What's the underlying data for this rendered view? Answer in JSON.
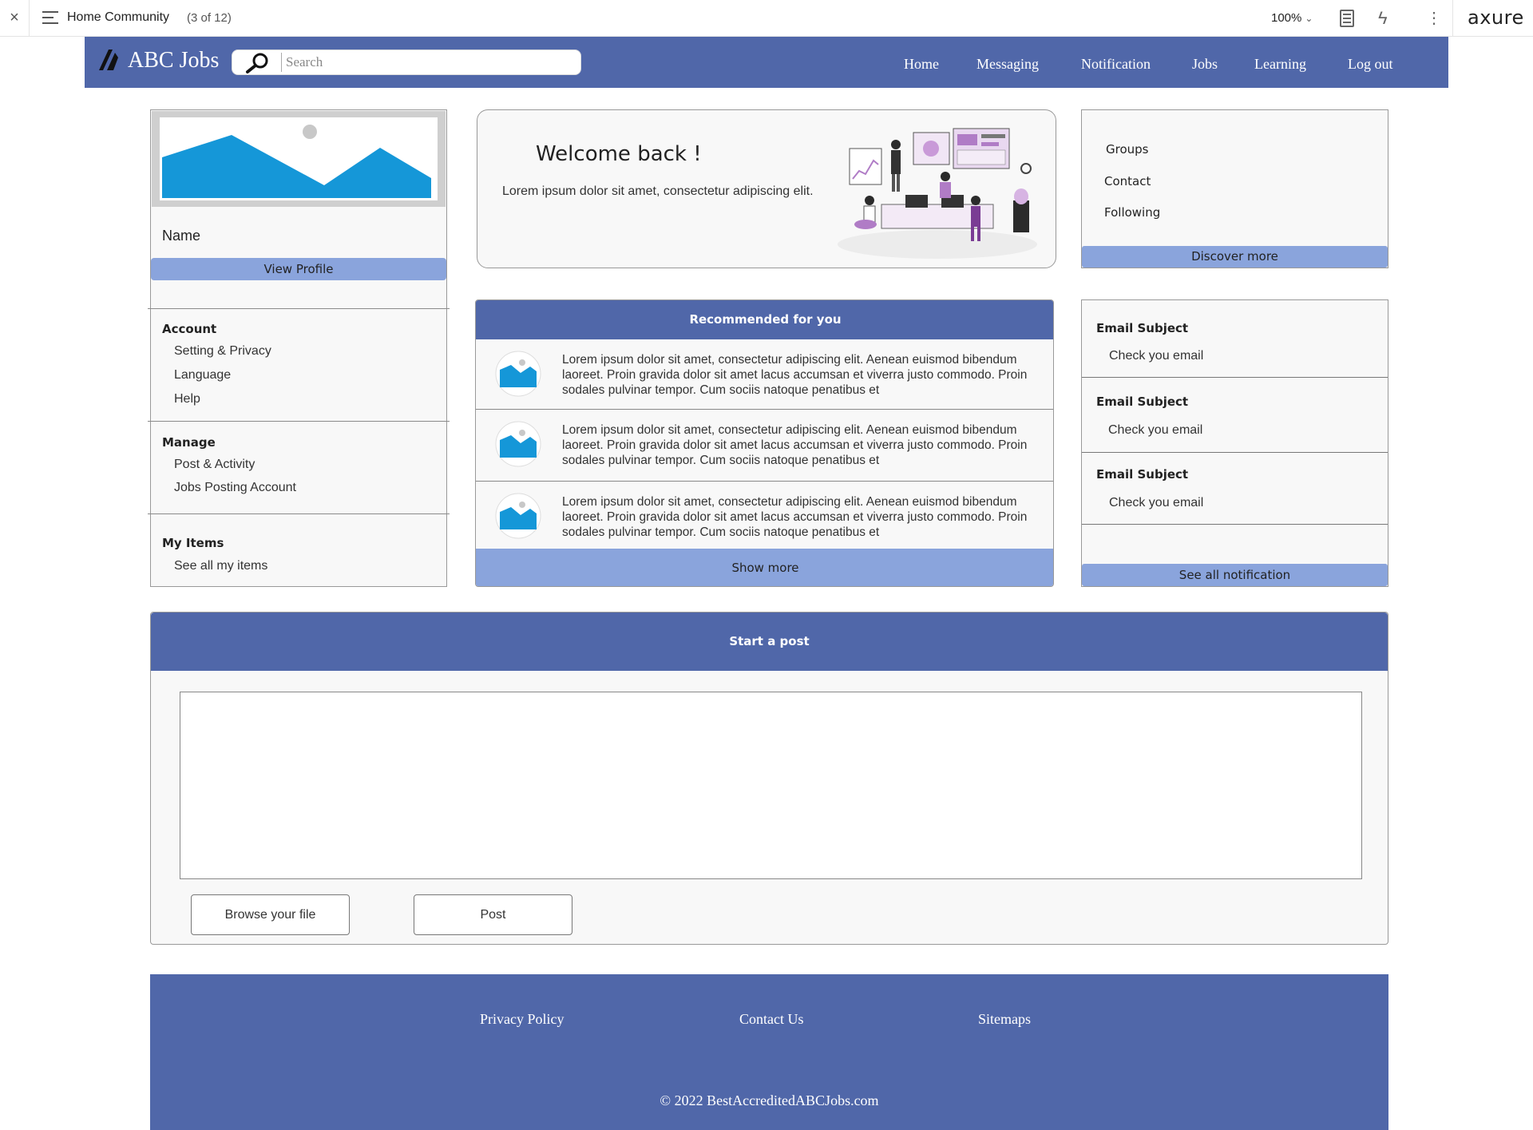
{
  "viewer": {
    "page_name": "Home Community",
    "page_count": "(3 of 12)",
    "zoom": "100%",
    "brand": "axure",
    "close_glyph": "×",
    "bolt_glyph": "ϟ",
    "more_glyph": "⋮",
    "chevron_glyph": "⌄"
  },
  "header": {
    "logo_text": "ABC Jobs",
    "search_placeholder": "Search",
    "nav": [
      "Home",
      "Messaging",
      "Notification",
      "Jobs",
      "Learning",
      "Log out"
    ]
  },
  "profile": {
    "name": "Name",
    "view_profile": "View Profile",
    "sections": [
      {
        "title": "Account",
        "items": [
          "Setting & Privacy",
          "Language",
          "Help"
        ]
      },
      {
        "title": "Manage",
        "items": [
          "Post & Activity",
          "Jobs Posting Account"
        ]
      },
      {
        "title": "My Items",
        "items": [
          "See all my items"
        ]
      }
    ]
  },
  "welcome": {
    "title": "Welcome back !",
    "subtitle": "Lorem ipsum dolor sit amet, consectetur adipiscing elit."
  },
  "groups": {
    "links": [
      "Groups",
      "Contact",
      "Following"
    ],
    "discover_more": "Discover more"
  },
  "recommended": {
    "title": "Recommended for you",
    "items": [
      "Lorem ipsum dolor sit amet, consectetur adipiscing elit. Aenean euismod bibendum laoreet. Proin gravida dolor sit amet lacus accumsan et viverra justo commodo. Proin sodales pulvinar tempor. Cum sociis natoque penatibus et",
      "Lorem ipsum dolor sit amet, consectetur adipiscing elit. Aenean euismod bibendum laoreet. Proin gravida dolor sit amet lacus accumsan et viverra justo commodo. Proin sodales pulvinar tempor. Cum sociis natoque penatibus et",
      "Lorem ipsum dolor sit amet, consectetur adipiscing elit. Aenean euismod bibendum laoreet. Proin gravida dolor sit amet lacus accumsan et viverra justo commodo. Proin sodales pulvinar tempor. Cum sociis natoque penatibus et"
    ],
    "show_more": "Show more"
  },
  "notifications": {
    "items": [
      {
        "subject": "Email Subject",
        "text": "Check you email"
      },
      {
        "subject": "Email Subject",
        "text": "Check you email"
      },
      {
        "subject": "Email Subject",
        "text": "Check you email"
      }
    ],
    "see_all": "See all notification"
  },
  "post": {
    "title": "Start a post",
    "browse_label": "Browse your file",
    "post_label": "Post"
  },
  "footer": {
    "links": [
      "Privacy Policy",
      "Contact Us",
      "Sitemaps"
    ],
    "copyright": "© 2022 BestAccreditedABCJobs.com"
  },
  "colors": {
    "brand_blue": "#5067a9",
    "light_blue": "#8aa4dc",
    "image_blue": "#1597d8"
  }
}
